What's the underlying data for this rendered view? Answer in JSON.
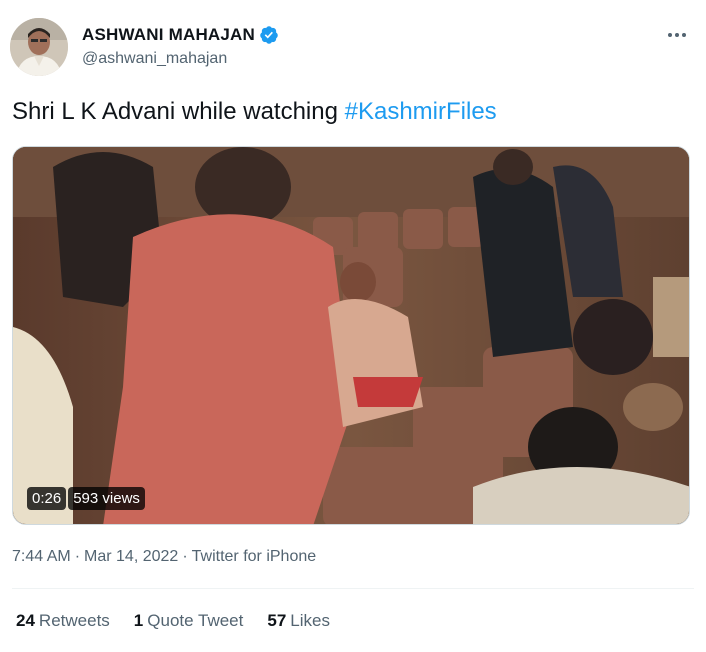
{
  "author": {
    "display_name": "ASHWANI MAHAJAN",
    "handle": "@ashwani_mahajan",
    "verified": true,
    "avatar_icon": "person-avatar"
  },
  "tweet": {
    "text_prefix": "Shri L K Advani while watching ",
    "hashtag": "#KashmirFiles",
    "hashtag_color": "#1d9bf0"
  },
  "media": {
    "type": "video",
    "duration": "0:26",
    "views": "593 views",
    "icon": "video-thumbnail"
  },
  "meta": {
    "time": "7:44 AM",
    "separator1": "·",
    "date": "Mar 14, 2022",
    "separator2": "·",
    "source": "Twitter for iPhone"
  },
  "stats": {
    "retweets_count": "24",
    "retweets_label": "Retweets",
    "quotes_count": "1",
    "quotes_label": "Quote Tweet",
    "likes_count": "57",
    "likes_label": "Likes"
  },
  "colors": {
    "text": "#0f1419",
    "secondary": "#536471",
    "accent": "#1d9bf0"
  },
  "menu_icon": "more-options-icon"
}
